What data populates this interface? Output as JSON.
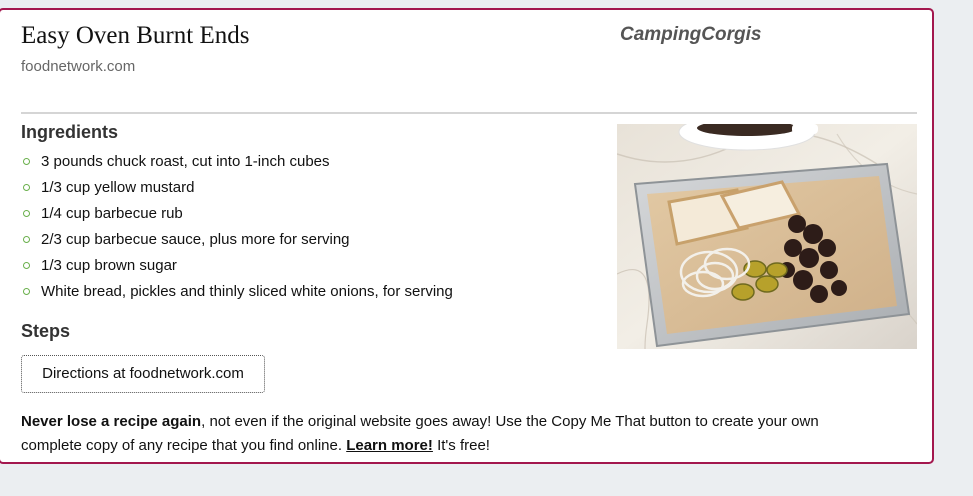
{
  "recipe": {
    "title": "Easy Oven Burnt Ends",
    "source": "foodnetwork.com",
    "author": "CampingCorgis"
  },
  "ingredients": {
    "heading": "Ingredients",
    "items": [
      "3 pounds chuck roast, cut into 1-inch cubes",
      "1/3 cup yellow mustard",
      "1/4 cup barbecue rub",
      "2/3 cup barbecue sauce, plus more for serving",
      "1/3 cup brown sugar",
      "White bread, pickles and thinly sliced white onions, for serving"
    ]
  },
  "steps": {
    "heading": "Steps",
    "directions_button": "Directions at foodnetwork.com"
  },
  "promo": {
    "bold_lead": "Never lose a recipe again",
    "text_1": ", not even if the original website goes away! Use the Copy Me That button to create your own complete copy of any recipe that you find online. ",
    "link": "Learn more!",
    "text_2": " It's free!"
  },
  "colors": {
    "card_border": "#a3174e",
    "bullet": "#6ab04c",
    "page_background": "#ebeef1"
  },
  "icons": {
    "bullet": "circle-bullet-icon"
  }
}
